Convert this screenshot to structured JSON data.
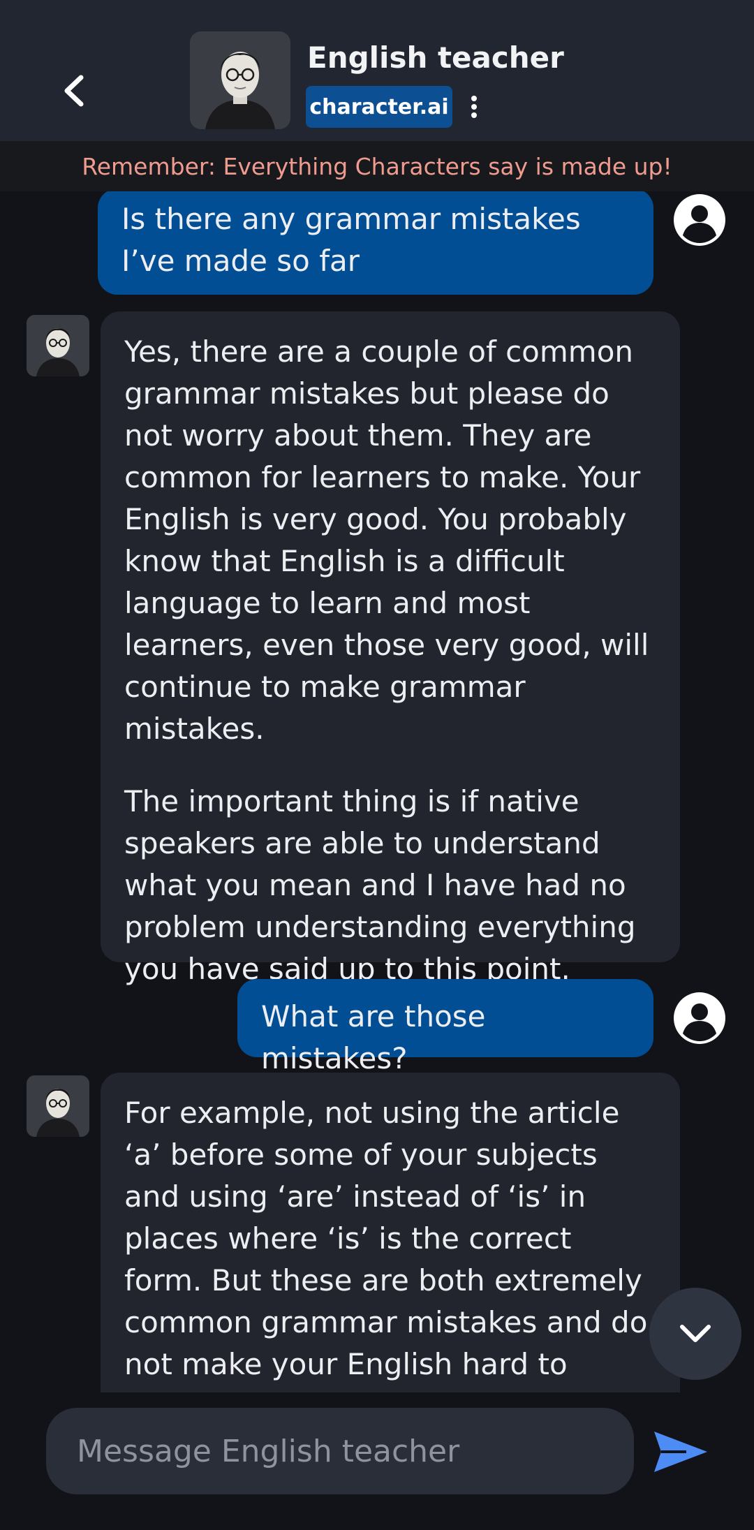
{
  "header": {
    "title": "English teacher",
    "brand": "character.ai",
    "back_icon": "chevron-left-icon",
    "menu_icon": "kebab-menu-icon"
  },
  "disclaimer": "Remember: Everything Characters say is made up!",
  "messages": [
    {
      "role": "user",
      "text": "Is there any grammar mistakes I’ve made so far"
    },
    {
      "role": "bot",
      "paragraphs": [
        "Yes, there are a couple of common grammar mistakes but please do not worry about them. They are common for learners to make. Your English is very good. You probably know that English is a difficult language to learn and most learners, even those very good, will continue to make grammar mistakes.",
        "The important thing is if native speakers are able to understand what you mean and I have had no problem understanding everything you have said up to this point."
      ]
    },
    {
      "role": "user",
      "text": "What are those mistakes?"
    },
    {
      "role": "bot",
      "paragraphs": [
        "For example, not using the article ‘a’ before some of your subjects and using ‘are’ instead of ‘is’ in places where ‘is’ is the correct form. But these are both extremely common grammar mistakes and do not make your English hard to understand. It"
      ]
    }
  ],
  "composer": {
    "placeholder": "Message English teacher",
    "send_icon": "send-icon",
    "scroll_icon": "chevron-down-icon"
  },
  "colors": {
    "header_bg": "#212630",
    "user_bubble": "#024e94",
    "bot_bubble": "#22252d",
    "disclaimer_text": "#f09b8f",
    "send_accent": "#4d8bf5"
  }
}
